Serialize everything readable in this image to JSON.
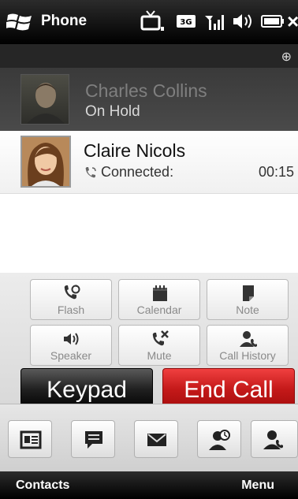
{
  "status_bar": {
    "app_title": "Phone",
    "icons": [
      "windows-start-icon",
      "tv-icon",
      "3g-icon",
      "signal-icon",
      "volume-icon",
      "battery-icon",
      "close-icon"
    ]
  },
  "held_call": {
    "name": "Charles Collins",
    "status": "On Hold"
  },
  "active_call": {
    "name": "Claire Nicols",
    "status": "Connected:",
    "timer": "00:15"
  },
  "actions": {
    "flash": "Flash",
    "calendar": "Calendar",
    "note": "Note",
    "speaker": "Speaker",
    "mute": "Mute",
    "call_history": "Call History",
    "keypad": "Keypad",
    "end_call": "End Call"
  },
  "shortcuts": [
    "contact-card-icon",
    "message-icon",
    "email-icon",
    "appointment-icon",
    "call-history-icon"
  ],
  "softkeys": {
    "left": "Contacts",
    "right": "Menu"
  },
  "colors": {
    "end_call": "#c41919",
    "keypad": "#1a1a1a",
    "status_bar": "#000000"
  }
}
